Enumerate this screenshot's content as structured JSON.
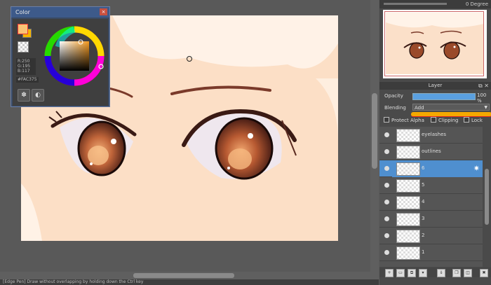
{
  "color_window": {
    "title": "Color",
    "close_label": "×",
    "rgb_lines": [
      "R:250",
      "G:195",
      "B:117"
    ],
    "hex": "#FAC375",
    "main_color": "#fac375"
  },
  "navigator": {
    "angle_label": "0 Degree"
  },
  "layer_panel": {
    "title": "Layer",
    "opacity_label": "Opacity",
    "opacity_value": "100 %",
    "blending_label": "Blending",
    "blending_value": "Add",
    "protect_alpha_label": "Protect Alpha",
    "clipping_label": "Clipping",
    "lock_label": "Lock",
    "layers": [
      {
        "name": "eyelashes",
        "selected": false
      },
      {
        "name": "outlines",
        "selected": false
      },
      {
        "name": "6",
        "selected": true
      },
      {
        "name": "5",
        "selected": false
      },
      {
        "name": "4",
        "selected": false
      },
      {
        "name": "3",
        "selected": false
      },
      {
        "name": "2",
        "selected": false
      },
      {
        "name": "1",
        "selected": false
      }
    ]
  },
  "status_bar": {
    "text": "[Edge Pen] Draw without overlapping by holding down the Ctrl key"
  },
  "colors": {
    "accent": "#4f8fcf",
    "skin": "#fbe0c9",
    "iris": "#6b2a1f"
  }
}
